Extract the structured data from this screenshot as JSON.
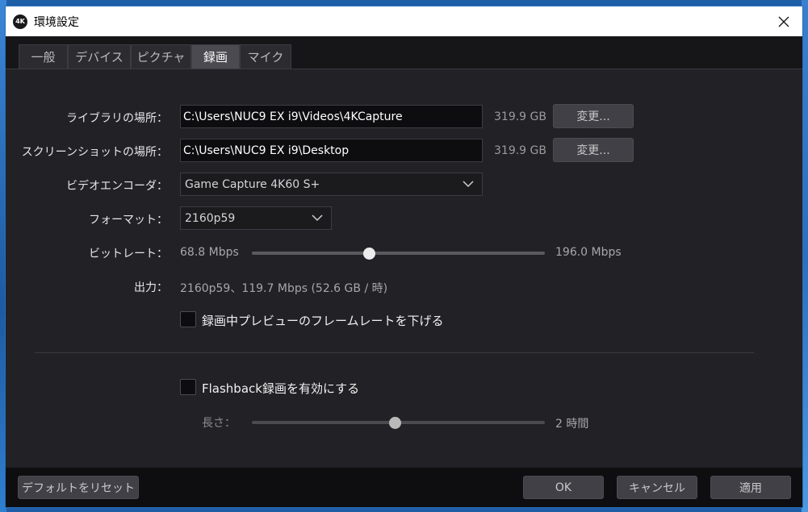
{
  "window": {
    "app_icon_text": "4K",
    "title": "環境設定",
    "close_glyph": "✕"
  },
  "tabs": [
    {
      "label": "一般"
    },
    {
      "label": "デバイス"
    },
    {
      "label": "ピクチャ"
    },
    {
      "label": "録画",
      "active": true
    },
    {
      "label": "マイク"
    }
  ],
  "library": {
    "label": "ライブラリの場所：",
    "path": "C:\\Users\\NUC9 EX i9\\Videos\\4KCapture",
    "free_space": "319.9 GB",
    "change_label": "変更..."
  },
  "screenshot": {
    "label": "スクリーンショットの場所：",
    "path": "C:\\Users\\NUC9 EX i9\\Desktop",
    "free_space": "319.9 GB",
    "change_label": "変更..."
  },
  "encoder": {
    "label": "ビデオエンコーダ：",
    "selected": "Game Capture 4K60 S+"
  },
  "format": {
    "label": "フォーマット：",
    "selected": "2160p59"
  },
  "bitrate": {
    "label": "ビットレート：",
    "min_text": "68.8 Mbps",
    "max_text": "196.0 Mbps",
    "level": 0.4
  },
  "output": {
    "label": "出力：",
    "value": "2160p59、119.7 Mbps (52.6 GB / 時)"
  },
  "preview_checkbox": {
    "label": "録画中プレビューのフレームレートを下げる",
    "checked": false
  },
  "flashback": {
    "label": "Flashback録画を有効にする",
    "checked": false,
    "length_label": "長さ：",
    "length_value": "2 時間",
    "level": 0.49
  },
  "footer": {
    "reset_label": "デフォルトをリセット",
    "ok_label": "OK",
    "cancel_label": "キャンセル",
    "apply_label": "適用"
  },
  "colors": {
    "dialog_bg": "#222226",
    "titlebar_bg": "#ffffff",
    "button_bg": "#404046",
    "field_bg": "#0d0d0f"
  },
  "icons": {
    "close": "close-icon",
    "dropdown": "chevron-down-icon",
    "app": "elgato-4k-icon"
  }
}
